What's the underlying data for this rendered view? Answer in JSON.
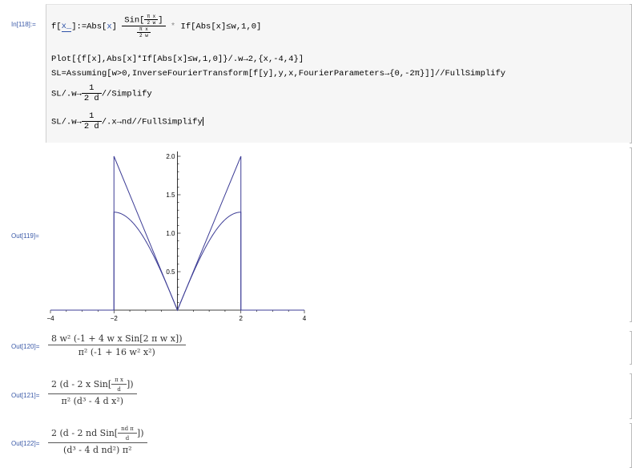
{
  "labels": {
    "in": "In[118]:=",
    "out119": "Out[119]=",
    "out120": "Out[120]=",
    "out121": "Out[121]=",
    "out122": "Out[122]="
  },
  "input": {
    "l1_head": "f[",
    "l1_arg": "x_",
    "l1_mid": "]:=Abs[",
    "l1_x": "x",
    "l1_close": "]",
    "l1_sin": "Sin",
    "l1_sin_arg_num": "π x",
    "l1_sin_arg_den": "2 w",
    "l1_den_num": "π x",
    "l1_den_den": "2 w",
    "l1_if": "If[Abs[x]≤w,1,0]",
    "l1_times": "*",
    "l2": "Plot[{f[x],Abs[x]*If[Abs[x]≤w,1,0]}/.w→2,{x,-4,4}]",
    "l3_a": "SL=Assuming[w>0,InverseFourierTransform[f[y],y,x,FourierParameters→{0,-2π}]]",
    "l3_b": "//FullSimplify",
    "l4_a": "SL/.w→",
    "l4_num": "1",
    "l4_den": "2 d",
    "l4_b": "//Simplify",
    "l5_a": "SL/.w→",
    "l5_num": "1",
    "l5_den": "2 d",
    "l5_b": "/.x→nd//FullSimplify"
  },
  "plot": {
    "chart_data": {
      "type": "line",
      "x": [
        -4,
        -3,
        -2.5,
        -2,
        -1.5,
        -1,
        -0.5,
        0,
        0.5,
        1,
        1.5,
        2,
        2.5,
        3,
        4
      ],
      "series": [
        {
          "values": [
            0,
            0,
            0,
            2,
            1.5,
            1,
            0.5,
            0,
            0.5,
            1,
            1.5,
            2,
            0,
            0,
            0
          ]
        },
        {
          "values": [
            0,
            0,
            0,
            1.27,
            1.2,
            0.9,
            0.49,
            0,
            0.49,
            0.9,
            1.2,
            1.27,
            0,
            0,
            0
          ]
        }
      ],
      "xlim": [
        -4,
        4
      ],
      "ylim": [
        0,
        2
      ],
      "xticks": [
        "-4",
        "-2",
        "2",
        "4"
      ],
      "yticks": [
        "0.5",
        "1.0",
        "1.5",
        "2.0"
      ],
      "title": "",
      "xlabel": "",
      "ylabel": ""
    }
  },
  "out120": {
    "num": "8 w² (-1 + 4 w x Sin[2 π w x])",
    "den": "π² (-1 + 16 w² x²)"
  },
  "out121": {
    "num_a": "2 (d - 2 x Sin[",
    "num_frac_n": "π x",
    "num_frac_d": "d",
    "num_b": "])",
    "den": "π² (d³ - 4 d x²)"
  },
  "out122": {
    "num_a": "2 (d - 2 nd Sin[",
    "num_frac_n": "nd π",
    "num_frac_d": "d",
    "num_b": "])",
    "den": "(d³ - 4 d nd²) π²"
  }
}
